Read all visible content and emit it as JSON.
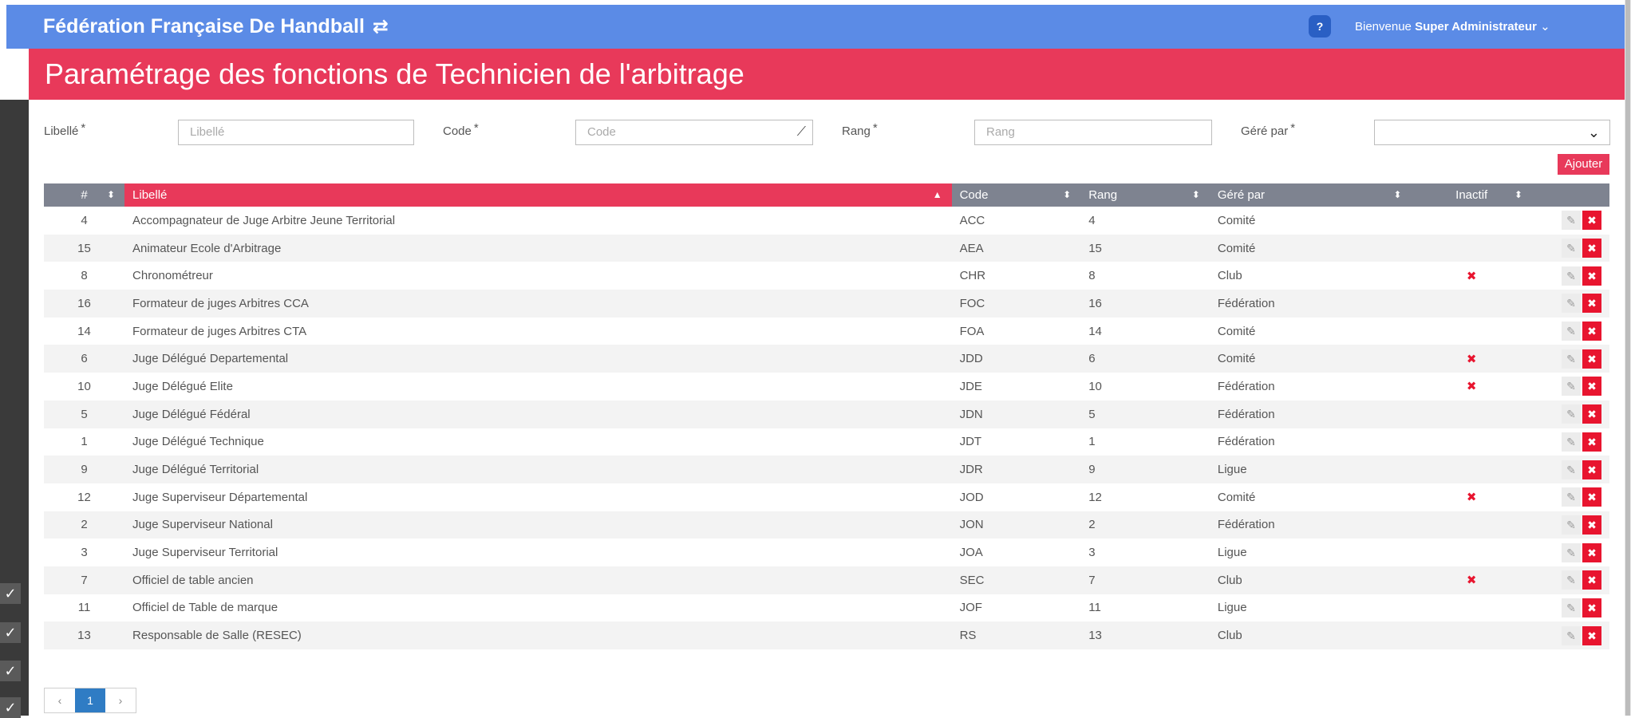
{
  "header": {
    "brand": "Fédération Française De Handball",
    "swap_icon": "⇄",
    "help": "?",
    "welcome_prefix": "Bienvenue",
    "user": "Super Administrateur",
    "chevron": "⌄"
  },
  "page": {
    "title": "Paramétrage des fonctions de Technicien de l'arbitrage"
  },
  "form": {
    "libelle_label": "Libellé",
    "libelle_placeholder": "Libellé",
    "code_label": "Code",
    "code_placeholder": "Code",
    "rang_label": "Rang",
    "rang_placeholder": "Rang",
    "gere_label": "Géré par",
    "gere_value": "",
    "required_mark": "*",
    "add_button": "Ajouter"
  },
  "table": {
    "columns": [
      "#",
      "Libellé",
      "Code",
      "Rang",
      "Géré par",
      "Inactif"
    ],
    "rows": [
      {
        "id": "4",
        "libelle": "Accompagnateur de Juge Arbitre Jeune Territorial",
        "code": "ACC",
        "rang": "4",
        "gere": "Comité",
        "inactif": ""
      },
      {
        "id": "15",
        "libelle": "Animateur Ecole d'Arbitrage",
        "code": "AEA",
        "rang": "15",
        "gere": "Comité",
        "inactif": ""
      },
      {
        "id": "8",
        "libelle": "Chronométreur",
        "code": "CHR",
        "rang": "8",
        "gere": "Club",
        "inactif": "✖"
      },
      {
        "id": "16",
        "libelle": "Formateur de juges Arbitres CCA",
        "code": "FOC",
        "rang": "16",
        "gere": "Fédération",
        "inactif": ""
      },
      {
        "id": "14",
        "libelle": "Formateur de juges Arbitres CTA",
        "code": "FOA",
        "rang": "14",
        "gere": "Comité",
        "inactif": ""
      },
      {
        "id": "6",
        "libelle": "Juge Délégué Departemental",
        "code": "JDD",
        "rang": "6",
        "gere": "Comité",
        "inactif": "✖"
      },
      {
        "id": "10",
        "libelle": "Juge Délégué Elite",
        "code": "JDE",
        "rang": "10",
        "gere": "Fédération",
        "inactif": "✖"
      },
      {
        "id": "5",
        "libelle": "Juge Délégué Fédéral",
        "code": "JDN",
        "rang": "5",
        "gere": "Fédération",
        "inactif": ""
      },
      {
        "id": "1",
        "libelle": "Juge Délégué Technique",
        "code": "JDT",
        "rang": "1",
        "gere": "Fédération",
        "inactif": ""
      },
      {
        "id": "9",
        "libelle": "Juge Délégué Territorial",
        "code": "JDR",
        "rang": "9",
        "gere": "Ligue",
        "inactif": ""
      },
      {
        "id": "12",
        "libelle": "Juge Superviseur Départemental",
        "code": "JOD",
        "rang": "12",
        "gere": "Comité",
        "inactif": "✖"
      },
      {
        "id": "2",
        "libelle": "Juge Superviseur National",
        "code": "JON",
        "rang": "2",
        "gere": "Fédération",
        "inactif": ""
      },
      {
        "id": "3",
        "libelle": "Juge Superviseur Territorial",
        "code": "JOA",
        "rang": "3",
        "gere": "Ligue",
        "inactif": ""
      },
      {
        "id": "7",
        "libelle": "Officiel de table ancien",
        "code": "SEC",
        "rang": "7",
        "gere": "Club",
        "inactif": "✖"
      },
      {
        "id": "11",
        "libelle": "Officiel de Table de marque",
        "code": "JOF",
        "rang": "11",
        "gere": "Ligue",
        "inactif": ""
      },
      {
        "id": "13",
        "libelle": "Responsable de Salle (RESEC)",
        "code": "RS",
        "rang": "13",
        "gere": "Club",
        "inactif": ""
      }
    ]
  },
  "pagination": {
    "prev": "‹",
    "current": "1",
    "next": "›"
  }
}
